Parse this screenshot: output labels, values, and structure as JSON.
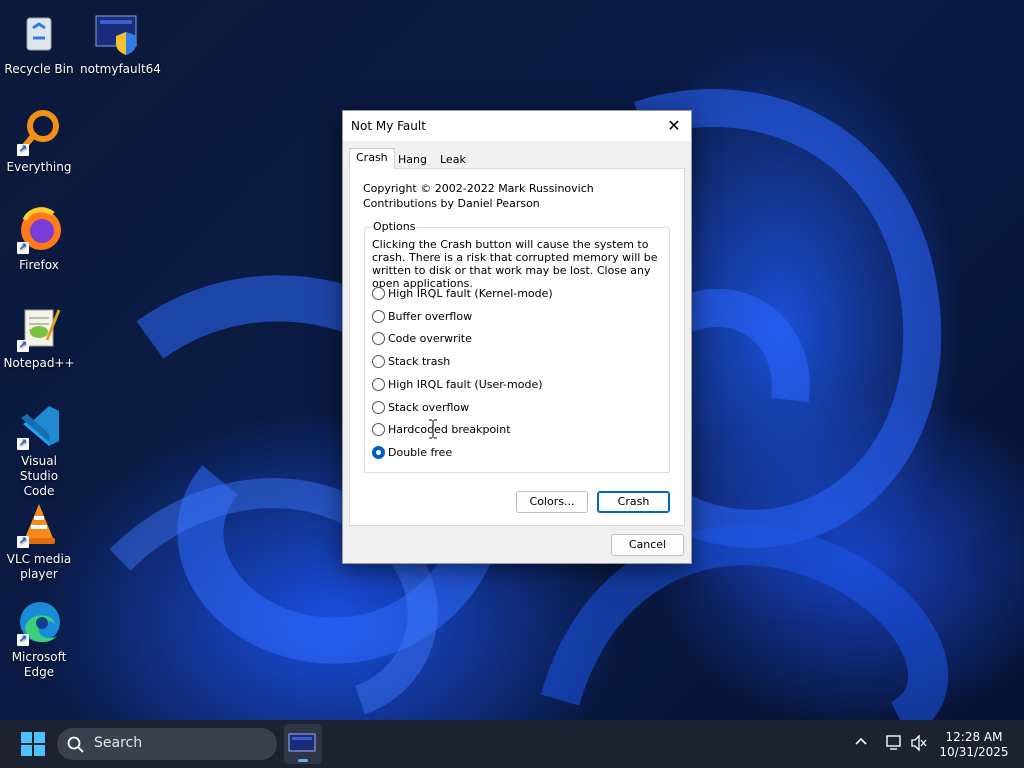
{
  "desktop": {
    "icons": [
      {
        "label": "Recycle Bin"
      },
      {
        "label": "notmyfault64"
      },
      {
        "label": "Everything"
      },
      {
        "label": "Firefox"
      },
      {
        "label": "Notepad++"
      },
      {
        "label": "Visual Studio Code"
      },
      {
        "label": "VLC media player"
      },
      {
        "label": "Microsoft Edge"
      }
    ]
  },
  "dialog": {
    "title": "Not My Fault",
    "tabs": [
      "Crash",
      "Hang",
      "Leak"
    ],
    "active_tab": "Crash",
    "copyright_line1": "Copyright © 2002-2022 Mark Russinovich",
    "copyright_line2": "Contributions by Daniel Pearson",
    "options_label": "Options",
    "options_desc": "Clicking the Crash button will cause the system to crash. There is a risk that corrupted memory will be written to disk or that work may be lost. Close any open applications.",
    "options": [
      {
        "label": "High IRQL fault (Kernel-mode)",
        "checked": false
      },
      {
        "label": "Buffer overflow",
        "checked": false
      },
      {
        "label": "Code overwrite",
        "checked": false
      },
      {
        "label": "Stack trash",
        "checked": false
      },
      {
        "label": "High IRQL fault (User-mode)",
        "checked": false
      },
      {
        "label": "Stack overflow",
        "checked": false
      },
      {
        "label": "Hardcoded breakpoint",
        "checked": false
      },
      {
        "label": "Double free",
        "checked": true
      }
    ],
    "colors_button": "Colors...",
    "crash_button": "Crash",
    "cancel_button": "Cancel"
  },
  "taskbar": {
    "search_placeholder": "Search",
    "time": "12:28 AM",
    "date": "10/31/2025"
  },
  "colors": {
    "accent": "#0067c0",
    "taskbar_bg": "#1c2230"
  }
}
